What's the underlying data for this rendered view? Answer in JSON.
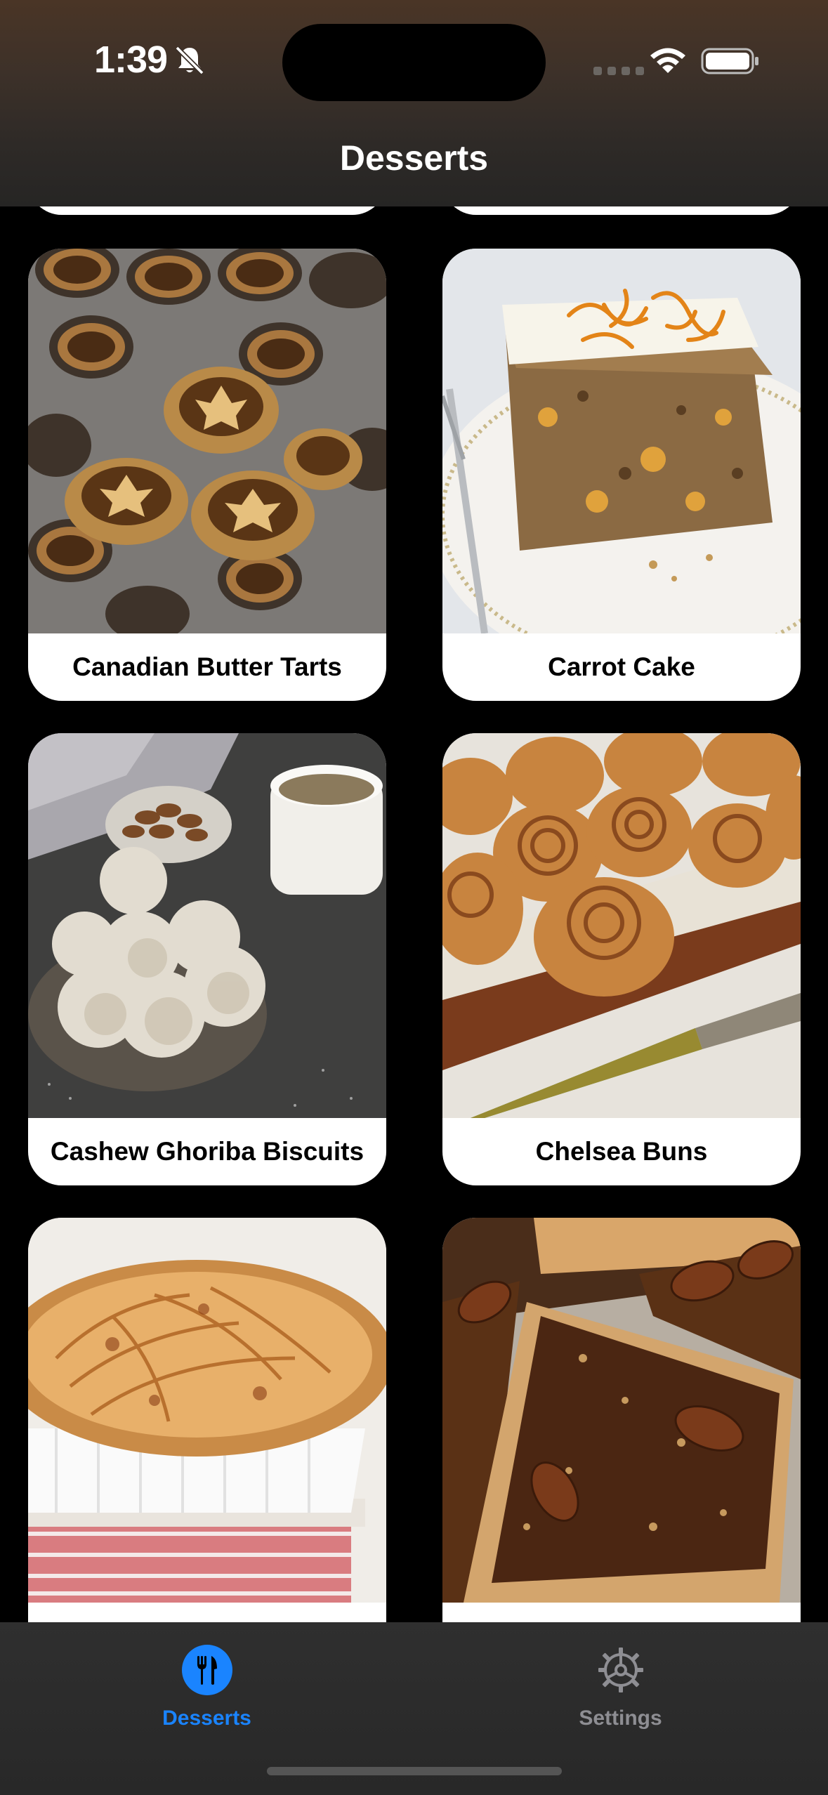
{
  "status_bar": {
    "time": "1:39"
  },
  "nav": {
    "title": "Desserts"
  },
  "desserts": [
    {
      "name": "Canadian Butter Tarts"
    },
    {
      "name": "Carrot Cake"
    },
    {
      "name": "Cashew Ghoriba Biscuits"
    },
    {
      "name": "Chelsea Buns"
    },
    {
      "name": ""
    },
    {
      "name": ""
    }
  ],
  "tabs": [
    {
      "label": "Desserts",
      "icon": "fork-knife-icon",
      "selected": true,
      "color": "#1a84ff"
    },
    {
      "label": "Settings",
      "icon": "gear-icon",
      "selected": false,
      "color": "#8e8e93"
    }
  ]
}
